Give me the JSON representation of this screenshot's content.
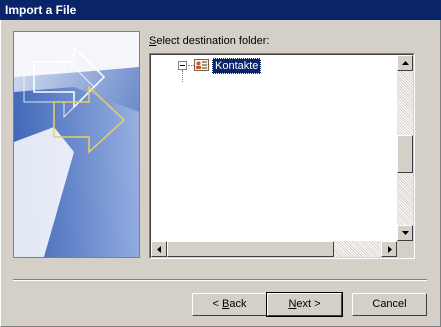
{
  "window": {
    "title": "Import a File"
  },
  "destination": {
    "label_accel": "S",
    "label_rest": "elect destination folder:"
  },
  "tree": {
    "items": [
      {
        "label": "Kontakte",
        "icon": "contacts-folder-icon",
        "selected": true,
        "expanded": true
      }
    ]
  },
  "buttons": {
    "back": {
      "prefix": "< ",
      "accel": "B",
      "rest": "ack"
    },
    "next": {
      "accel": "N",
      "rest": "ext >"
    },
    "cancel": {
      "label": "Cancel"
    }
  },
  "colors": {
    "titlebar": "#0a246a",
    "selection": "#0a246a",
    "face": "#d4d0c8"
  }
}
